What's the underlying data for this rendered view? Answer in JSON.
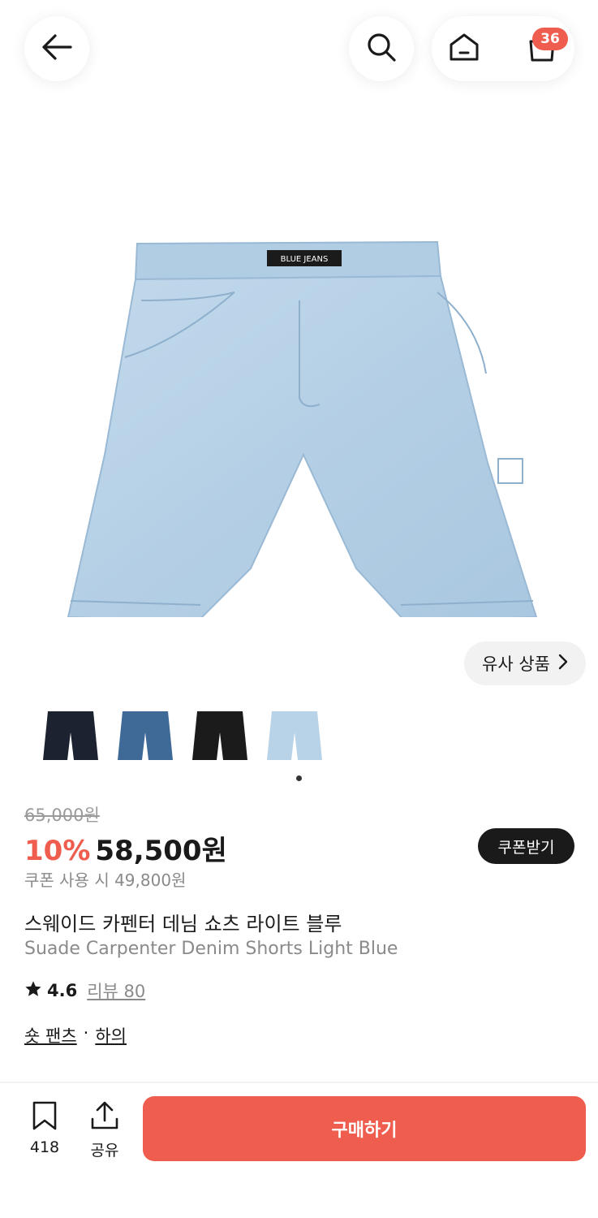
{
  "header": {
    "cart_count": "36",
    "icons": [
      "back-arrow-icon",
      "search-icon",
      "home-icon",
      "shopping-bag-icon"
    ]
  },
  "gallery": {
    "similar_label": "유사 상품",
    "thumbnail_colors": [
      "#1c2230",
      "#3f6a98",
      "#1b1b1b",
      "#b8d3e8"
    ],
    "selected_index": 3
  },
  "pricing": {
    "original_price": "65,000원",
    "discount": "10%",
    "sale_price": "58,500원",
    "coupon_button": "쿠폰받기",
    "coupon_price": "쿠폰 사용 시 49,800원"
  },
  "product": {
    "title_ko": "스웨이드 카펜터 데님 쇼츠 라이트 블루",
    "title_en": "Suade Carpenter Denim Shorts Light Blue",
    "rating": "4.6",
    "reviews": "리뷰 80",
    "category_1": "숏 팬츠",
    "category_sep": "·",
    "category_2": "하의"
  },
  "bottom_bar": {
    "bookmark_count": "418",
    "share_label": "공유",
    "buy_label": "구매하기"
  },
  "colors": {
    "accent": "#ef5d4e",
    "dark": "#1a1a1a",
    "denim_light": "#b7d1e6"
  }
}
